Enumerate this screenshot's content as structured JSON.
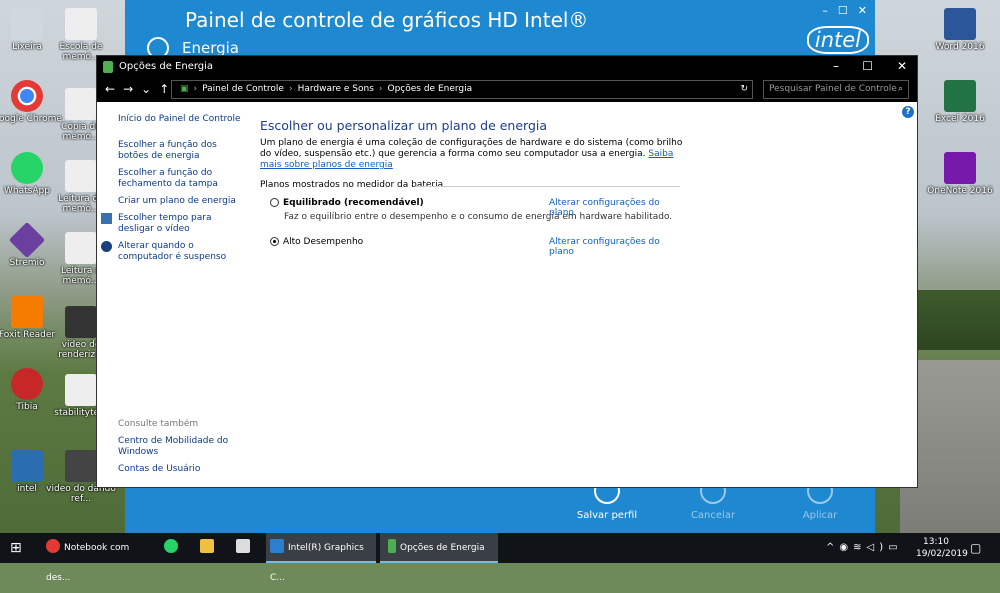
{
  "desktop": {
    "icons": [
      {
        "label": "Lixeira",
        "color": "#cfd8dc"
      },
      {
        "label": "Escola de memó...",
        "color": "#eeeeee"
      },
      {
        "label": "Google Chrome",
        "color": "#e53935"
      },
      {
        "label": "Cópia de memó...",
        "color": "#eeeeee"
      },
      {
        "label": "WhatsApp",
        "color": "#25d366"
      },
      {
        "label": "Leitura de memó...",
        "color": "#eeeeee"
      },
      {
        "label": "Stremio",
        "color": "#6a3fa0"
      },
      {
        "label": "Leitura d memó...",
        "color": "#eeeeee"
      },
      {
        "label": "Foxit Reader",
        "color": "#f57c00"
      },
      {
        "label": "video do renderiz...",
        "color": "#333333"
      },
      {
        "label": "Tibia",
        "color": "#c62828"
      },
      {
        "label": "stabilityte...",
        "color": "#eeeeee"
      },
      {
        "label": "intel",
        "color": "#2a6db0"
      },
      {
        "label": "video do dando ref...",
        "color": "#444444"
      },
      {
        "label": "Word 2016",
        "color": "#2b579a"
      },
      {
        "label": "Excel 2016",
        "color": "#217346"
      },
      {
        "label": "OneNote 2016",
        "color": "#7719aa"
      }
    ]
  },
  "intel": {
    "title": "Painel de controle de gráficos HD Intel®",
    "section": "Energia",
    "logo": "intel",
    "buttons": {
      "save": "Salvar perfil",
      "cancel": "Cancelar",
      "apply": "Aplicar"
    }
  },
  "power": {
    "window_title": "Opções de Energia",
    "breadcrumb": [
      "Painel de Controle",
      "Hardware e Sons",
      "Opções de Energia"
    ],
    "search_placeholder": "Pesquisar Painel de Controle",
    "left_nav": {
      "home": "Início do Painel de Controle",
      "power_buttons": "Escolher a função dos botões de energia",
      "lid": "Escolher a função do fechamento da tampa",
      "create_plan": "Criar um plano de energia",
      "display_off": "Escolher tempo para desligar o vídeo",
      "sleep": "Alterar quando o computador é suspenso",
      "see_also": "Consulte também",
      "mobility": "Centro de Mobilidade do Windows",
      "accounts": "Contas de Usuário"
    },
    "heading": "Escolher ou personalizar um plano de energia",
    "description": "Um plano de energia é uma coleção de configurações de hardware e do sistema (como brilho do vídeo, suspensão etc.) que gerencia a forma como seu computador usa a energia. ",
    "learn_more": "Saiba mais sobre planos de energia",
    "group_label": "Planos mostrados no medidor da bateria",
    "plans": [
      {
        "name": "Equilibrado (recomendável)",
        "desc": "Faz o equilíbrio entre o desempenho e o consumo de energia em hardware habilitado.",
        "link": "Alterar configurações do plano",
        "selected": false
      },
      {
        "name": "Alto Desempenho",
        "desc": "",
        "link": "Alterar configurações do plano",
        "selected": true
      }
    ]
  },
  "taskbar": {
    "items": [
      {
        "label": "Notebook com des...",
        "color": "#e53935"
      },
      {
        "label": "",
        "color": "#25d366"
      },
      {
        "label": "",
        "color": "#f0c040"
      },
      {
        "label": "",
        "color": "#dddddd"
      },
      {
        "label": "Intel(R) Graphics C...",
        "color": "#2a7fd0"
      },
      {
        "label": "Opções de Energia",
        "color": "#4caf50"
      }
    ],
    "time": "13:10",
    "date": "19/02/2019"
  }
}
